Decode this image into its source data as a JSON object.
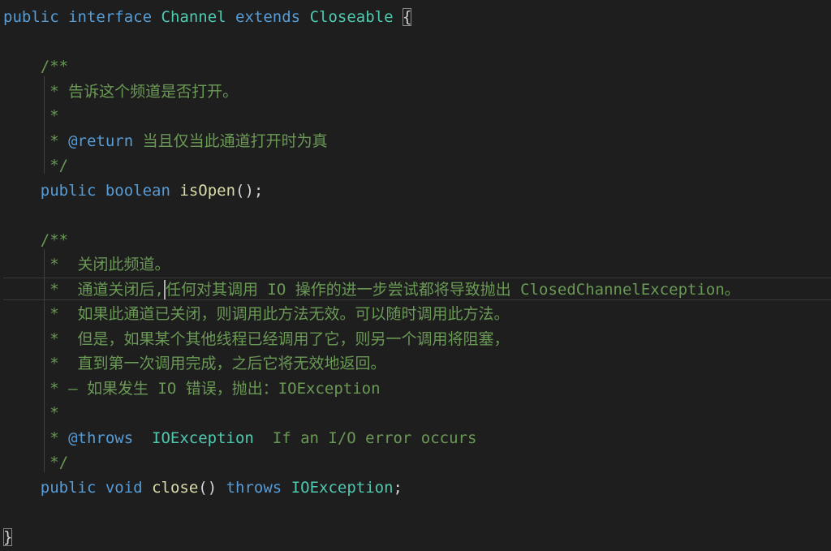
{
  "editor": {
    "language": "java",
    "cursor_line": 12,
    "lines": [
      {
        "n": 1,
        "tokens": [
          {
            "t": "public",
            "c": "kw"
          },
          {
            "t": " ",
            "c": "pu"
          },
          {
            "t": "interface",
            "c": "kw"
          },
          {
            "t": " ",
            "c": "pu"
          },
          {
            "t": "Channel",
            "c": "ty"
          },
          {
            "t": " ",
            "c": "pu"
          },
          {
            "t": "extends",
            "c": "kw"
          },
          {
            "t": " ",
            "c": "pu"
          },
          {
            "t": "Closeable",
            "c": "ty"
          },
          {
            "t": " ",
            "c": "pu"
          },
          {
            "t": "{",
            "c": "br",
            "match": true
          }
        ]
      },
      {
        "n": 2,
        "tokens": []
      },
      {
        "n": 3,
        "tokens": [
          {
            "t": "    /**",
            "c": "cm"
          }
        ]
      },
      {
        "n": 4,
        "tokens": [
          {
            "t": "     * 告诉这个频道是否打开。",
            "c": "cm"
          }
        ]
      },
      {
        "n": 5,
        "tokens": [
          {
            "t": "     *",
            "c": "cm"
          }
        ]
      },
      {
        "n": 6,
        "tokens": [
          {
            "t": "     * ",
            "c": "cm"
          },
          {
            "t": "@return",
            "c": "tag"
          },
          {
            "t": " 当且仅当此通道打开时为真",
            "c": "cm"
          }
        ]
      },
      {
        "n": 7,
        "tokens": [
          {
            "t": "     */",
            "c": "cm"
          }
        ]
      },
      {
        "n": 8,
        "tokens": [
          {
            "t": "    ",
            "c": "pu"
          },
          {
            "t": "public",
            "c": "kw"
          },
          {
            "t": " ",
            "c": "pu"
          },
          {
            "t": "boolean",
            "c": "kw"
          },
          {
            "t": " ",
            "c": "pu"
          },
          {
            "t": "isOpen",
            "c": "fn"
          },
          {
            "t": "();",
            "c": "pu"
          }
        ]
      },
      {
        "n": 9,
        "tokens": []
      },
      {
        "n": 10,
        "tokens": [
          {
            "t": "    /**",
            "c": "cm"
          }
        ]
      },
      {
        "n": 11,
        "tokens": [
          {
            "t": "     *  关闭此频道。",
            "c": "cm"
          }
        ]
      },
      {
        "n": 12,
        "tokens": [
          {
            "t": "     *  通道关闭后,",
            "c": "cm"
          },
          {
            "t": "",
            "c": "caret"
          },
          {
            "t": "任何对其调用 IO 操作的进一步尝试都将导致抛出 ClosedChannelException。",
            "c": "cm"
          }
        ]
      },
      {
        "n": 13,
        "tokens": [
          {
            "t": "     *  如果此通道已关闭，则调用此方法无效。可以随时调用此方法。",
            "c": "cm"
          }
        ]
      },
      {
        "n": 14,
        "tokens": [
          {
            "t": "     *  但是，如果某个其他线程已经调用了它，则另一个调用将阻塞，",
            "c": "cm"
          }
        ]
      },
      {
        "n": 15,
        "tokens": [
          {
            "t": "     *  直到第一次调用完成，之后它将无效地返回。",
            "c": "cm"
          }
        ]
      },
      {
        "n": 16,
        "tokens": [
          {
            "t": "     * — 如果发生 IO 错误，抛出：IOException",
            "c": "cm"
          }
        ]
      },
      {
        "n": 17,
        "tokens": [
          {
            "t": "     *",
            "c": "cm"
          }
        ]
      },
      {
        "n": 18,
        "tokens": [
          {
            "t": "     * ",
            "c": "cm"
          },
          {
            "t": "@throws",
            "c": "tag"
          },
          {
            "t": "  ",
            "c": "cm"
          },
          {
            "t": "IOException",
            "c": "ty"
          },
          {
            "t": "  If an I/O error occurs",
            "c": "cm"
          }
        ]
      },
      {
        "n": 19,
        "tokens": [
          {
            "t": "     */",
            "c": "cm"
          }
        ]
      },
      {
        "n": 20,
        "tokens": [
          {
            "t": "    ",
            "c": "pu"
          },
          {
            "t": "public",
            "c": "kw"
          },
          {
            "t": " ",
            "c": "pu"
          },
          {
            "t": "void",
            "c": "kw"
          },
          {
            "t": " ",
            "c": "pu"
          },
          {
            "t": "close",
            "c": "fn"
          },
          {
            "t": "() ",
            "c": "pu"
          },
          {
            "t": "throws",
            "c": "kw"
          },
          {
            "t": " ",
            "c": "pu"
          },
          {
            "t": "IOException",
            "c": "ty"
          },
          {
            "t": ";",
            "c": "pu"
          }
        ]
      },
      {
        "n": 21,
        "tokens": []
      },
      {
        "n": 22,
        "tokens": [
          {
            "t": "}",
            "c": "br",
            "match": true
          }
        ]
      }
    ]
  }
}
